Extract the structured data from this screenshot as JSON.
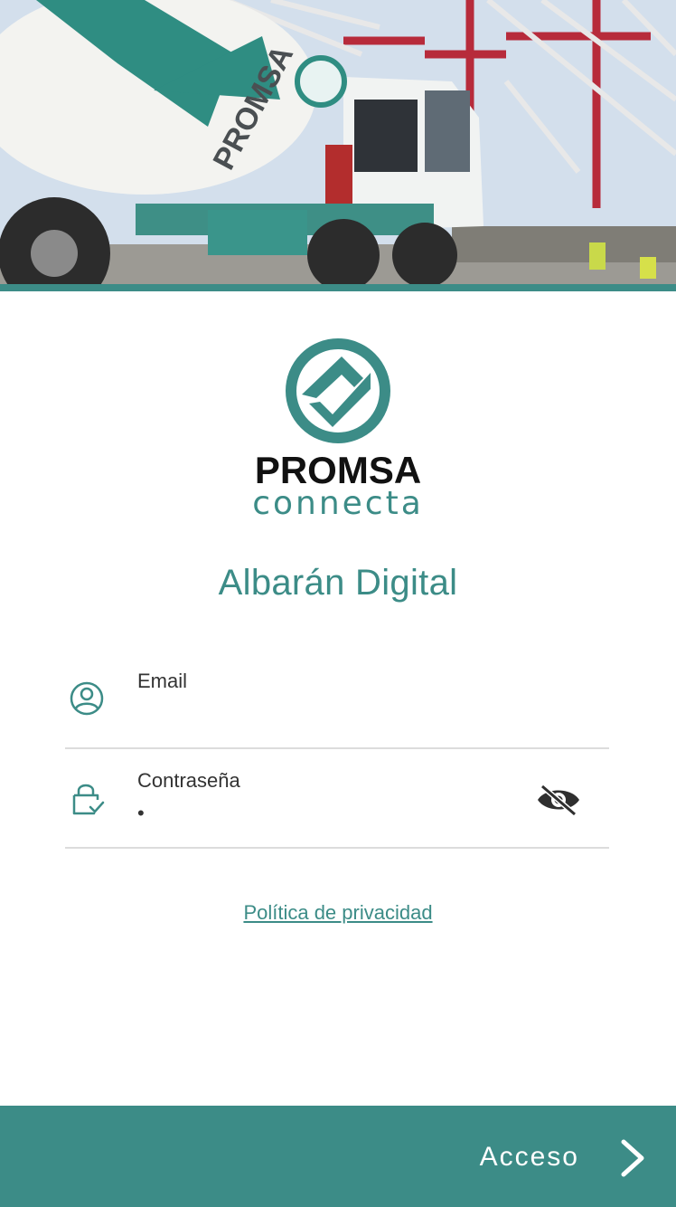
{
  "hero": {
    "image": "concrete-mixer-truck-photo",
    "truck_lettering": "PROMSA"
  },
  "brand": {
    "logo_top": "PROMSA",
    "logo_bottom": "connecta",
    "accent_color": "#3c8c87",
    "wordmark_color": "#111111"
  },
  "title": "Albarán Digital",
  "form": {
    "email": {
      "label": "Email",
      "value": "",
      "icon": "user-circle-icon"
    },
    "password": {
      "label": "Contraseña",
      "masked_value": "•",
      "icon": "lock-check-icon",
      "toggle_icon": "eye-slash-icon"
    }
  },
  "privacy_link": "Política de privacidad",
  "access": {
    "label": "Acceso",
    "icon": "chevron-right-icon"
  }
}
